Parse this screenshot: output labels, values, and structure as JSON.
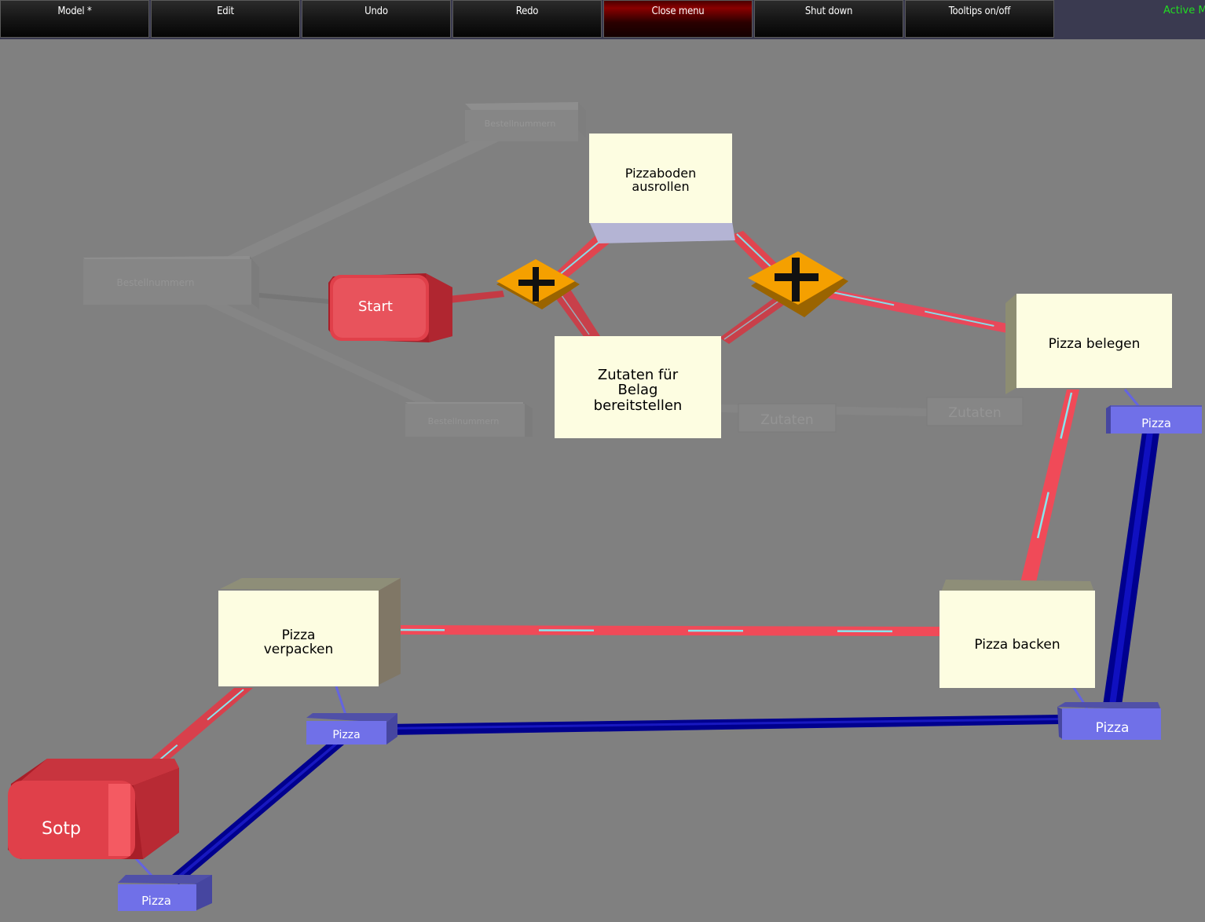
{
  "menu": {
    "items": [
      {
        "label": "Model *"
      },
      {
        "label": "Edit"
      },
      {
        "label": "Undo"
      },
      {
        "label": "Redo"
      },
      {
        "label": "Close menu"
      },
      {
        "label": "Shut down"
      },
      {
        "label": "Tooltips on/off"
      }
    ],
    "active_mode": "Active Mo"
  },
  "colors": {
    "background": "#808080",
    "task": "#fdfde1",
    "event": "#e04a50",
    "gateway": "#f5a000",
    "data_object": "#7070e8",
    "data_flow": "#00009a",
    "control_flow": "#e84a55",
    "ghost": "#8a8a8a"
  },
  "diagram": {
    "events": {
      "start": "Start",
      "stop": "Sotp"
    },
    "tasks": {
      "pizzaboden_1": "Pizzaboden",
      "pizzaboden_2": "ausrollen",
      "zutaten_1": "Zutaten für",
      "zutaten_2": "Belag",
      "zutaten_3": "bereitstellen",
      "belegen": "Pizza belegen",
      "backen": "Pizza backen",
      "verpacken_1": "Pizza",
      "verpacken_2": "verpacken"
    },
    "data_objects": {
      "pizza_1": "Pizza",
      "pizza_2": "Pizza",
      "pizza_3": "Pizza",
      "pizza_4": "Pizza"
    },
    "ghost_objects": {
      "bestellnummern_1": "Bestellnummern",
      "bestellnummern_2": "Bestellnummern",
      "bestellnummern_3": "Bestellnummern",
      "zutaten_1": "Zutaten",
      "zutaten_2": "Zutaten"
    }
  }
}
